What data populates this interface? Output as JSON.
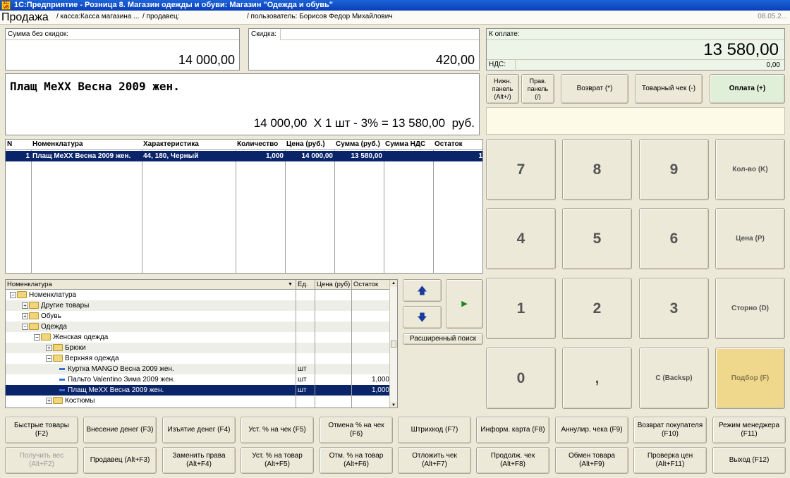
{
  "window": {
    "title": "1С:Предприятие - Розница 8. Магазин одежды и обуви: Магазин \"Одежда и обувь\"",
    "icon_name": "1c-app-icon"
  },
  "info": {
    "mode": "Продажа",
    "kassa": "/ касса:Касса магазина ...",
    "seller": "/ продавец:",
    "user": "/ пользователь: Борисов Федор Михайлович",
    "date": "08.05.2..."
  },
  "totals": {
    "sum_label": "Сумма без скидок:",
    "sum_value": "14 000,00",
    "discount_label": "Скидка:",
    "discount_value": "420,00",
    "pay_label": "К оплате:",
    "pay_value": "13 580,00",
    "vat_label": "НДС:",
    "vat_value": "0,00"
  },
  "display": {
    "product": "Плащ MeXX Весна 2009 жен.",
    "calc": "14 000,00  X 1 шт - 3% = 13 580,00  руб."
  },
  "top_buttons": [
    {
      "label": "Нижн.\nпанель\n(Alt+/)"
    },
    {
      "label": "Прав.\nпанель\n(/)"
    },
    {
      "label": "Возврат (*)"
    },
    {
      "label": "Товарный чек (-)"
    },
    {
      "label": "Оплата (+)"
    }
  ],
  "table": {
    "headers": [
      "N",
      "Номенклатура",
      "Характеристика",
      "Количество",
      "Цена (руб.)",
      "Сумма (руб.)",
      "Сумма НДС",
      "Остаток"
    ],
    "rows": [
      [
        "1",
        "Плащ MeXX Весна 2009 жен.",
        "44, 180, Черный",
        "1,000",
        "14 000,00",
        "13 580,00",
        "",
        "1"
      ]
    ]
  },
  "tree": {
    "headers": [
      "Номенклатура",
      "Ед.",
      "Цена (руб)",
      "Остаток"
    ],
    "rows": [
      {
        "name": "Номенклатура",
        "unit": "",
        "price": "",
        "stock": ""
      },
      {
        "name": "Другие товары",
        "unit": "",
        "price": "",
        "stock": ""
      },
      {
        "name": "Обувь",
        "unit": "",
        "price": "",
        "stock": ""
      },
      {
        "name": "Одежда",
        "unit": "",
        "price": "",
        "stock": ""
      },
      {
        "name": "Женская одежда",
        "unit": "",
        "price": "",
        "stock": ""
      },
      {
        "name": "Брюки",
        "unit": "",
        "price": "",
        "stock": ""
      },
      {
        "name": "Верхняя одежда",
        "unit": "",
        "price": "",
        "stock": ""
      },
      {
        "name": "Куртка MANGO Весна 2009 жен.",
        "unit": "шт",
        "price": "",
        "stock": ""
      },
      {
        "name": "Пальто Valentino Зима 2009 жен.",
        "unit": "шт",
        "price": "",
        "stock": "1,000"
      },
      {
        "name": "Плащ MeXX Весна 2009 жен.",
        "unit": "шт",
        "price": "",
        "stock": "1,000"
      },
      {
        "name": "Костюмы",
        "unit": "",
        "price": "",
        "stock": ""
      }
    ]
  },
  "nav": {
    "search": "Расширенный поиск"
  },
  "numpad": {
    "keys": [
      "7",
      "8",
      "9",
      "Кол-во (K)",
      "4",
      "5",
      "6",
      "Цена (P)",
      "1",
      "2",
      "3",
      "Сторно (D)",
      "0",
      ",",
      "C (Backsp)",
      "Подбор (F)"
    ],
    "highlight_color": "#efd88c"
  },
  "fbuttons_row1": [
    "Быстрые товары (F2)",
    "Внесение денег (F3)",
    "Изъятие денег (F4)",
    "Уст. % на чек (F5)",
    "Отмена % на чек (F6)",
    "Штрихкод (F7)",
    "Информ. карта (F8)",
    "Аннулир. чека (F9)",
    "Возврат покупателя\n(F10)",
    "Режим менеджера\n(F11)"
  ],
  "fbuttons_row2": [
    "Получить вес (Alt+F2)",
    "Продавец (Alt+F3)",
    "Заменить права\n(Alt+F4)",
    "Уст. % на товар\n(Alt+F5)",
    "Отм. % на товар\n(Alt+F6)",
    "Отложить чек (Alt+F7)",
    "Продолж. чек (Alt+F8)",
    "Обмен товара (Alt+F9)",
    "Проверка цен\n(Alt+F11)",
    "Выход (F12)"
  ],
  "colors": {
    "title_bar": "#0a3fb8",
    "selection": "#0a246a",
    "pay_panel": "#ecf5e8",
    "pay_button": "#e0efd8"
  }
}
